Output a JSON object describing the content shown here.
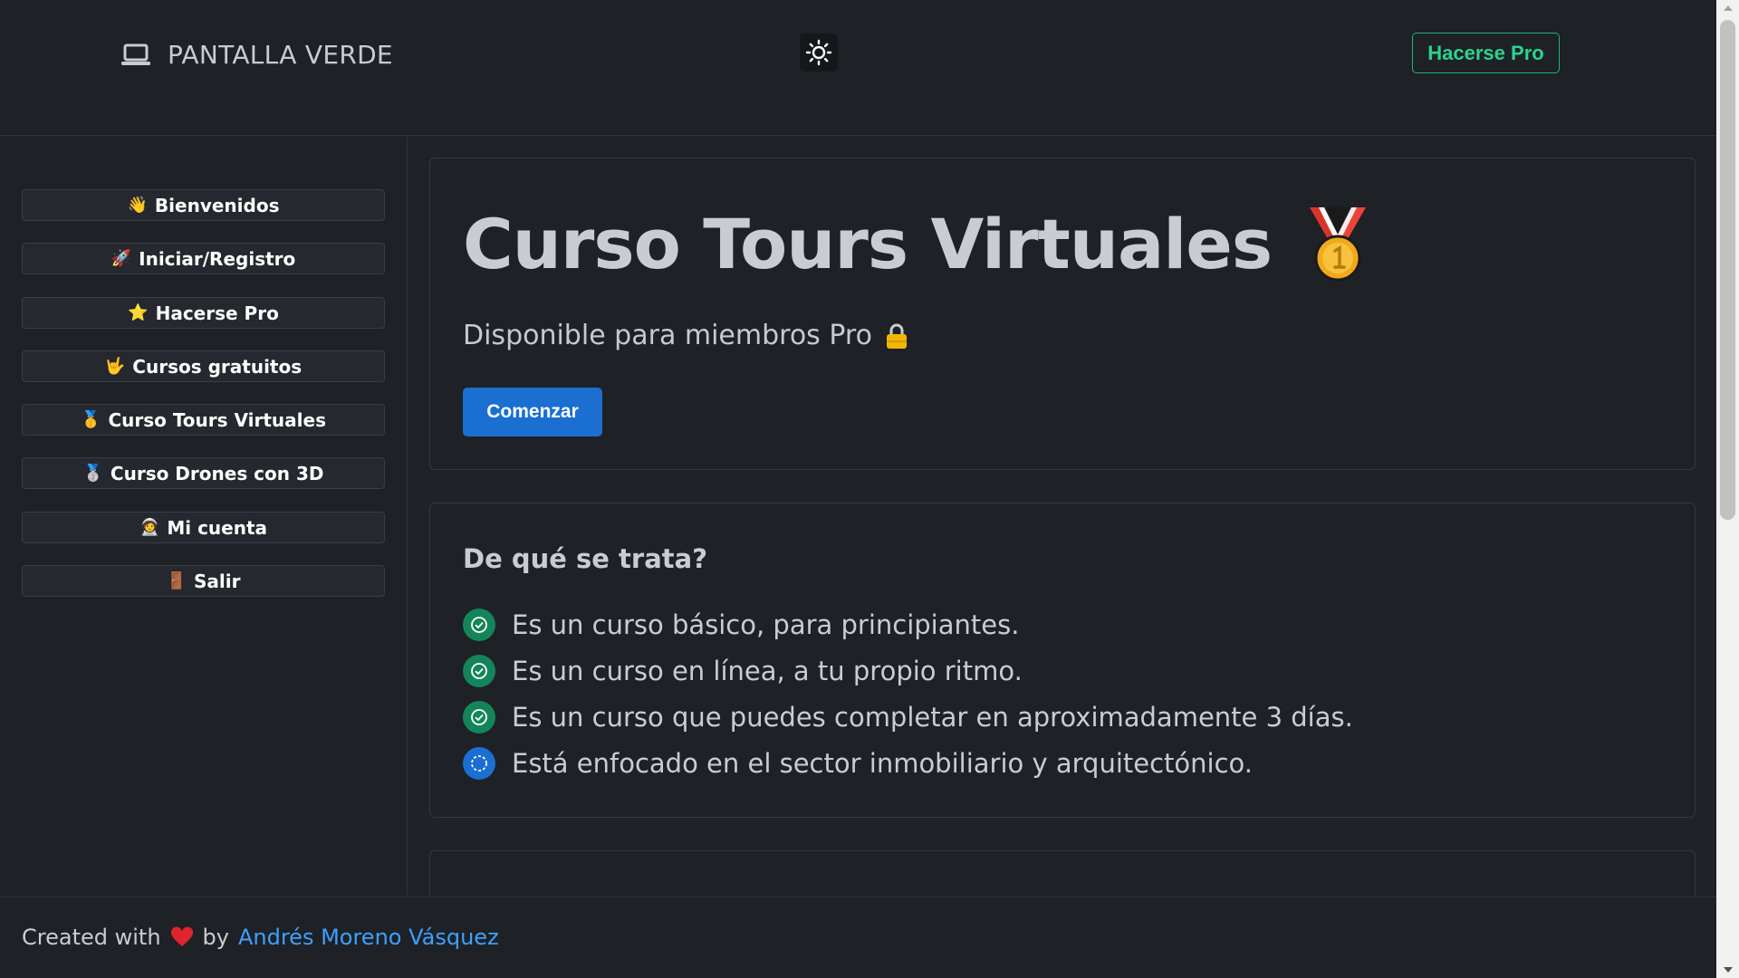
{
  "header": {
    "brand": "PANTALLA VERDE",
    "brand_icon": "laptop-icon",
    "theme_icon": "sun-icon",
    "pro_button": "Hacerse Pro"
  },
  "sidebar": {
    "items": [
      {
        "emoji": "👋",
        "label": "Bienvenidos"
      },
      {
        "emoji": "🚀",
        "label": "Iniciar/Registro"
      },
      {
        "emoji": "⭐",
        "label": "Hacerse Pro"
      },
      {
        "emoji": "🤟",
        "label": "Cursos gratuitos"
      },
      {
        "emoji": "🥇",
        "label": "Curso Tours Virtuales"
      },
      {
        "emoji": "🥈",
        "label": "Curso Drones con 3D"
      },
      {
        "emoji": "🧑‍🚀",
        "label": "Mi cuenta"
      },
      {
        "emoji": "🚪",
        "label": "Salir"
      }
    ]
  },
  "hero": {
    "title": "Curso Tours Virtuales",
    "subtitle": "Disponible para miembros Pro",
    "subtitle_icon": "lock-icon",
    "button": "Comenzar"
  },
  "about": {
    "title": "De qué se trata?",
    "features": [
      {
        "text": "Es un curso básico, para principiantes.",
        "icon": "check-circle-icon"
      },
      {
        "text": "Es un curso en línea, a tu propio ritmo.",
        "icon": "check-circle-icon"
      },
      {
        "text": "Es un curso que puedes completar en aproximadamente 3 días.",
        "icon": "check-circle-icon"
      },
      {
        "text": "Está enfocado en el sector inmobiliario y arquitectónico.",
        "icon": "dashed-circle-icon"
      }
    ]
  },
  "footer": {
    "prefix": "Created with",
    "by": "by",
    "author": "Andrés Moreno Vásquez"
  },
  "colors": {
    "background": "#1e2126",
    "accent_green": "#2bd38f",
    "accent_blue": "#1a6fd0",
    "link": "#3ea0ff"
  }
}
